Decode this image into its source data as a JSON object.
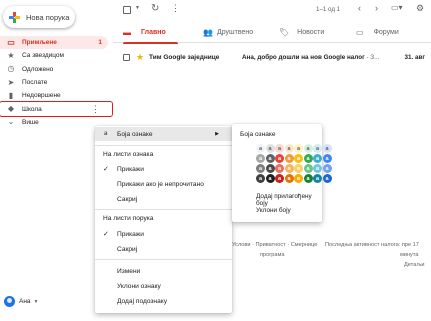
{
  "compose": {
    "label": "Нова порука"
  },
  "nav": {
    "items": [
      {
        "label": "Примљене",
        "count": "1",
        "icon": "inbox-icon",
        "glyph": "▭"
      },
      {
        "label": "Са звездицом",
        "icon": "star-icon",
        "glyph": "★"
      },
      {
        "label": "Одложено",
        "icon": "clock-icon",
        "glyph": "◷"
      },
      {
        "label": "Послате",
        "icon": "send-icon",
        "glyph": "➤"
      },
      {
        "label": "Недовршене",
        "icon": "draft-icon",
        "glyph": "▮"
      },
      {
        "label": "Школа",
        "icon": "label-icon",
        "glyph": "◆"
      },
      {
        "label": "Више",
        "icon": "expand-icon",
        "glyph": "⌄"
      }
    ]
  },
  "user": {
    "name": "Ана"
  },
  "toolbar": {
    "pager": "1–1 од 1"
  },
  "tabs": [
    {
      "label": "Главно",
      "icon": "inbox-tab-icon"
    },
    {
      "label": "Друштвено",
      "icon": "people-icon"
    },
    {
      "label": "Новости",
      "icon": "tag-icon"
    },
    {
      "label": "Форуми",
      "icon": "forum-icon"
    }
  ],
  "email": {
    "sender": "Тим Google заједнице",
    "subject": "Ана, добро дошли на нов Google налог",
    "snippet": " - З...",
    "date": "31. авг"
  },
  "footer": {
    "links": "Услови · Приватност · Смернице",
    "links2": "програма",
    "activity": "Последња активност налога: пре 17",
    "activity2": "минута",
    "details": "Детаљи"
  },
  "menu": {
    "label_color": "Боја ознаке",
    "in_label_list": "На листи ознака",
    "show": "Прикажи",
    "show_if_unread": "Прикажи ако је непрочитано",
    "hide": "Сакриј",
    "in_message_list": "На листи порука",
    "show2": "Прикажи",
    "hide2": "Сакриј",
    "edit": "Измени",
    "remove_label": "Уклони ознаку",
    "add_sublabel": "Додај подознаку"
  },
  "colors": {
    "title": "Боја ознаке",
    "swatch_letter": "a",
    "custom": "Додај прилагођену боју",
    "remove": "Уклони боју",
    "palette": [
      [
        "#f1f3f4",
        "#e0e0e0",
        "#fbd7d3",
        "#fde6c8",
        "#fff2c2",
        "#d7f0dd",
        "#d2ecf3",
        "#d5e2fb"
      ],
      [
        "#a7a7a7",
        "#5f6368",
        "#ea4335",
        "#f29b33",
        "#f4c10f",
        "#34a853",
        "#3cadd0",
        "#4285f4"
      ],
      [
        "#7e7e7e",
        "#4a4a4a",
        "#ef6c5a",
        "#f6b35a",
        "#fbd15c",
        "#6cc387",
        "#6fc6de",
        "#6f9df7"
      ],
      [
        "#3f3f3f",
        "#1f1f1f",
        "#c5221f",
        "#e37400",
        "#f9ab00",
        "#188038",
        "#12859e",
        "#1967d2"
      ]
    ]
  }
}
